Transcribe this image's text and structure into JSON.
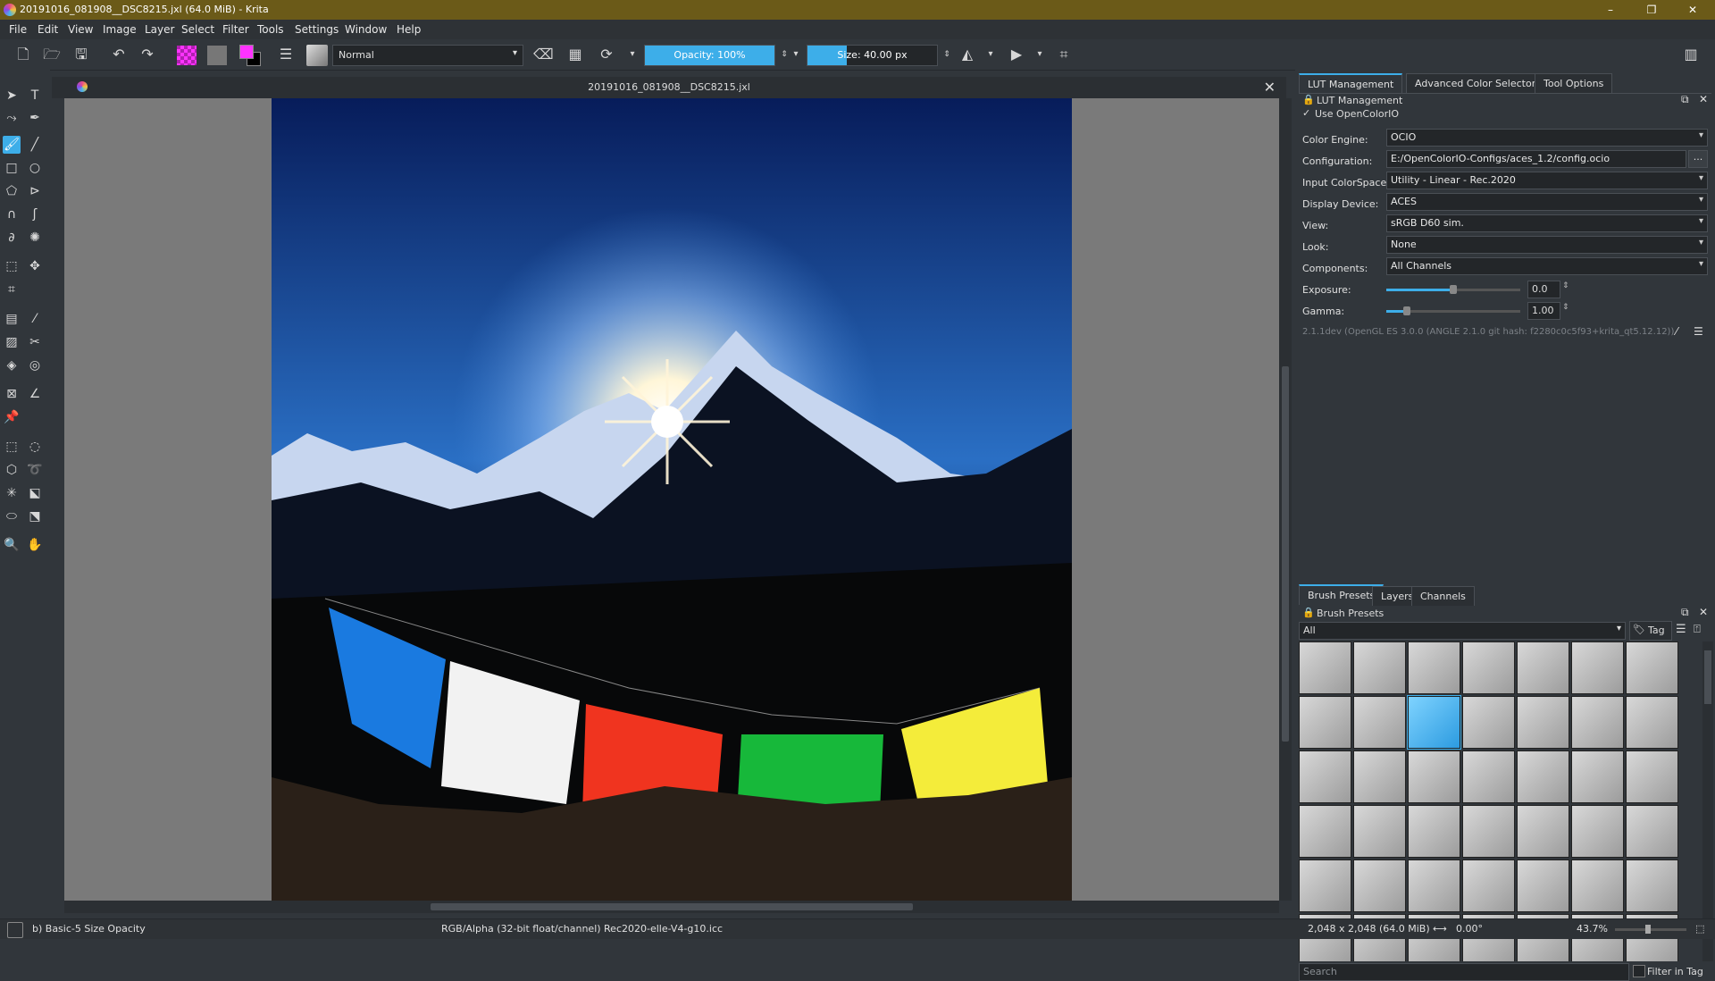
{
  "window": {
    "title": "20191016_081908__DSC8215.jxl (64.0 MiB)  - Krita",
    "minimize": "–",
    "maximize": "❐",
    "close": "✕"
  },
  "menu": [
    "File",
    "Edit",
    "View",
    "Image",
    "Layer",
    "Select",
    "Filter",
    "Tools",
    "Settings",
    "Window",
    "Help"
  ],
  "toolbar": {
    "blend_mode": "Normal",
    "opacity": "Opacity: 100%",
    "opacity_value": 100,
    "size": "Size: 40.00 px",
    "size_fill_fraction": 0.3
  },
  "document": {
    "tab_title": "20191016_081908__DSC8215.jxl",
    "close": "✕"
  },
  "docker_top": {
    "tabs": [
      "LUT Management",
      "Advanced Color Selector",
      "Tool Options"
    ],
    "active_tab": "LUT Management",
    "panel_title": "LUT Management",
    "use_ocio_check": "✓",
    "use_ocio_label": "Use OpenColorIO",
    "rows": [
      {
        "label": "Color Engine:",
        "value": "OCIO"
      },
      {
        "label": "Configuration:",
        "value": "E:/OpenColorIO-Configs/aces_1.2/config.ocio"
      },
      {
        "label": "Input ColorSpace:",
        "value": "Utility - Linear - Rec.2020"
      },
      {
        "label": "Display Device:",
        "value": "ACES"
      },
      {
        "label": "View:",
        "value": "sRGB D60 sim."
      },
      {
        "label": "Look:",
        "value": "None"
      },
      {
        "label": "Components:",
        "value": "All Channels"
      }
    ],
    "browse_button": "...",
    "exposure_label": "Exposure:",
    "exposure_value": "0.0",
    "exposure_level": 0.5,
    "gamma_label": "Gamma:",
    "gamma_value": "1.00",
    "gamma_level": 0.15,
    "version_info": "2.1.1dev (OpenGL ES 3.0.0 (ANGLE 2.1.0 git hash: f2280c0c5f93+krita_qt5.12.12))"
  },
  "docker_bottom": {
    "tabs": [
      "Brush Presets",
      "Layers",
      "Channels"
    ],
    "active_tab": "Brush Presets",
    "panel_title": "Brush Presets",
    "filter_value": "All",
    "tag_button": "Tag",
    "search_placeholder": "Search",
    "filter_in_tag": "Filter in Tag"
  },
  "status": {
    "brush": "b) Basic-5 Size Opacity",
    "color_info": "RGB/Alpha (32-bit float/channel)  Rec2020-elle-V4-g10.icc",
    "dimensions": "2,048 x 2,048 (64.0 MiB)",
    "rotation": "0.00°",
    "zoom": "43.7%"
  },
  "colors": {
    "accent": "#3daee9",
    "titlebar": "#6b5a18",
    "foreground_swatch": "#ff33ff",
    "background_swatch": "#000000"
  }
}
